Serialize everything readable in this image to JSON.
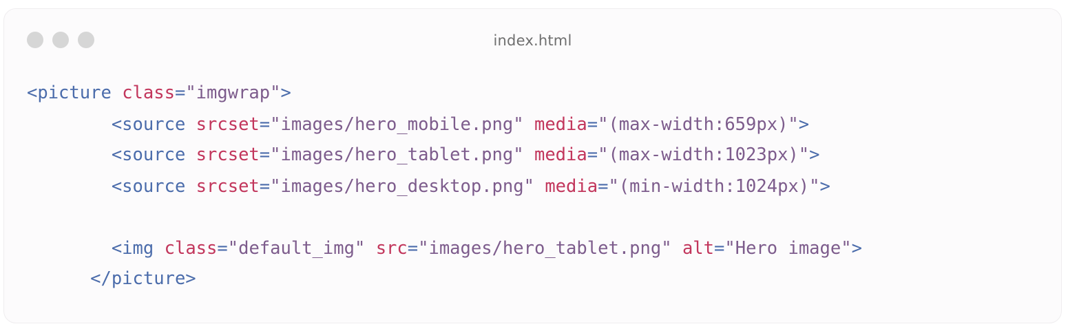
{
  "window": {
    "filename": "index.html"
  },
  "code": {
    "lines": [
      {
        "indent": "",
        "parts": [
          {
            "t": "tag",
            "v": "<picture"
          },
          {
            "t": "plain",
            "v": " "
          },
          {
            "t": "attr",
            "v": "class"
          },
          {
            "t": "eq",
            "v": "="
          },
          {
            "t": "str",
            "v": "\"imgwrap\""
          },
          {
            "t": "tag",
            "v": ">"
          }
        ]
      },
      {
        "indent": "        ",
        "parts": [
          {
            "t": "tag",
            "v": "<source"
          },
          {
            "t": "plain",
            "v": " "
          },
          {
            "t": "attr",
            "v": "srcset"
          },
          {
            "t": "eq",
            "v": "="
          },
          {
            "t": "str",
            "v": "\"images/hero_mobile.png\""
          },
          {
            "t": "plain",
            "v": " "
          },
          {
            "t": "attr",
            "v": "media"
          },
          {
            "t": "eq",
            "v": "="
          },
          {
            "t": "str",
            "v": "\"(max-width:659px)\""
          },
          {
            "t": "tag",
            "v": ">"
          }
        ]
      },
      {
        "indent": "        ",
        "parts": [
          {
            "t": "tag",
            "v": "<source"
          },
          {
            "t": "plain",
            "v": " "
          },
          {
            "t": "attr",
            "v": "srcset"
          },
          {
            "t": "eq",
            "v": "="
          },
          {
            "t": "str",
            "v": "\"images/hero_tablet.png\""
          },
          {
            "t": "plain",
            "v": " "
          },
          {
            "t": "attr",
            "v": "media"
          },
          {
            "t": "eq",
            "v": "="
          },
          {
            "t": "str",
            "v": "\"(max-width:1023px)\""
          },
          {
            "t": "tag",
            "v": ">"
          }
        ]
      },
      {
        "indent": "        ",
        "parts": [
          {
            "t": "tag",
            "v": "<source"
          },
          {
            "t": "plain",
            "v": " "
          },
          {
            "t": "attr",
            "v": "srcset"
          },
          {
            "t": "eq",
            "v": "="
          },
          {
            "t": "str",
            "v": "\"images/hero_desktop.png\""
          },
          {
            "t": "plain",
            "v": " "
          },
          {
            "t": "attr",
            "v": "media"
          },
          {
            "t": "eq",
            "v": "="
          },
          {
            "t": "str",
            "v": "\"(min-width:1024px)\""
          },
          {
            "t": "tag",
            "v": ">"
          }
        ]
      },
      {
        "indent": "",
        "parts": []
      },
      {
        "indent": "        ",
        "parts": [
          {
            "t": "tag",
            "v": "<img"
          },
          {
            "t": "plain",
            "v": " "
          },
          {
            "t": "attr",
            "v": "class"
          },
          {
            "t": "eq",
            "v": "="
          },
          {
            "t": "str",
            "v": "\"default_img\""
          },
          {
            "t": "plain",
            "v": " "
          },
          {
            "t": "attr",
            "v": "src"
          },
          {
            "t": "eq",
            "v": "="
          },
          {
            "t": "str",
            "v": "\"images/hero_tablet.png\""
          },
          {
            "t": "plain",
            "v": " "
          },
          {
            "t": "attr",
            "v": "alt"
          },
          {
            "t": "eq",
            "v": "="
          },
          {
            "t": "str",
            "v": "\"Hero image\""
          },
          {
            "t": "tag",
            "v": ">"
          }
        ]
      },
      {
        "indent": "      ",
        "parts": [
          {
            "t": "tag",
            "v": "</picture>"
          }
        ]
      }
    ]
  },
  "colors": {
    "tag": "#4b6cab",
    "attribute": "#c2365c",
    "string": "#7d5c8c",
    "window_dot": "#d6d6d6"
  }
}
